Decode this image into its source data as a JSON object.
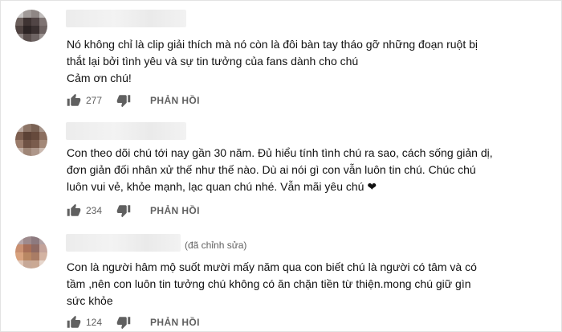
{
  "comments": [
    {
      "edited_label": "",
      "lines": [
        "Nó không chỉ là clip giải thích mà nó còn là đôi bàn tay tháo gỡ những đoạn ruột bị",
        "thắt lại bởi tình yêu và sự tin tưởng của fans dành cho chú",
        "Cảm ơn chú!"
      ],
      "like_count": "277",
      "reply_label": "PHẢN HỒI"
    },
    {
      "edited_label": "",
      "lines": [
        "Con theo dõi chú tới nay gần 30 năm. Đủ hiểu tính tình chú ra sao, cách sống giản dị,",
        "đơn giản đối nhân xử thế như thế nào.  Dù ai nói gì con vẫn luôn tin chú. Chúc chú",
        "luôn vui vẻ, khỏe mạnh, lạc quan chú nhé. Vẫn mãi yêu chú ❤"
      ],
      "like_count": "234",
      "reply_label": "PHẢN HỒI"
    },
    {
      "edited_label": "(đã chỉnh sửa)",
      "lines": [
        "Con là người hâm mộ suốt mười mấy năm qua con biết chú là người có tâm và có",
        "tầm ,nên con  luôn tin tưởng chú không có ăn chặn tiền từ thiện.mong chú giữ gìn",
        "sức khỏe"
      ],
      "like_count": "124",
      "reply_label": "PHẢN HỒI"
    }
  ],
  "icons": {
    "like": "thumbs-up-icon",
    "dislike": "thumbs-down-icon"
  },
  "colors": {
    "text": "#0f0f0f",
    "meta": "#606060"
  }
}
